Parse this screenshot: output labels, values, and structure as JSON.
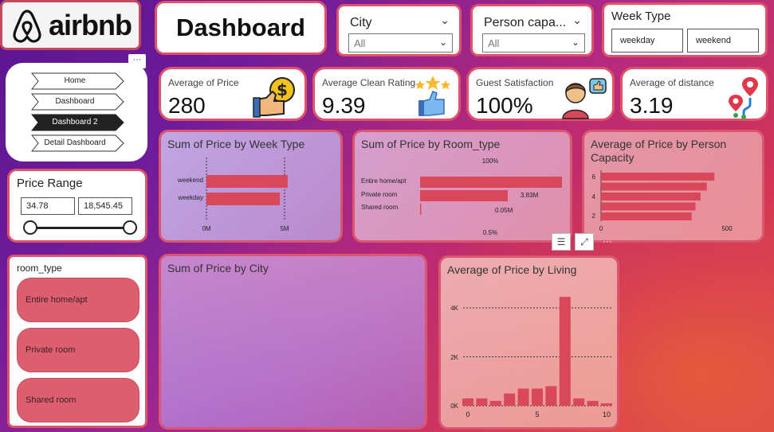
{
  "logo": {
    "word": "airbnb"
  },
  "header": {
    "title": "Dashboard"
  },
  "slicers": {
    "city": {
      "label": "City",
      "value": "All"
    },
    "person": {
      "label": "Person capa...",
      "value": "All"
    },
    "week_type": {
      "label": "Week Type",
      "options": [
        "weekday",
        "weekend"
      ]
    }
  },
  "more_label": "···",
  "nav": {
    "items": [
      {
        "label": "Home",
        "active": false
      },
      {
        "label": "Dashboard",
        "active": false
      },
      {
        "label": "Dashboard 2",
        "active": true
      },
      {
        "label": "Detail Dashboard",
        "active": false
      }
    ]
  },
  "price_range": {
    "title": "Price Range",
    "min": "34.78",
    "max": "18,545.45"
  },
  "room_type_slicer": {
    "title": "room_type",
    "items": [
      "Entire home/apt",
      "Private room",
      "Shared room"
    ]
  },
  "kpis": [
    {
      "label": "Average of Price",
      "value": "280",
      "icon": "money-hand-icon"
    },
    {
      "label": "Average Clean Rating",
      "value": "9.39",
      "icon": "thumbs-stars-icon"
    },
    {
      "label": "Guest Satisfaction",
      "value": "100%",
      "icon": "satisfied-guest-icon"
    },
    {
      "label": "Average of distance",
      "value": "3.19",
      "icon": "route-pin-icon"
    }
  ],
  "colors": {
    "accent": "#e0516a",
    "bar": "#d9485a"
  },
  "chart_data": [
    {
      "type": "bar",
      "orientation": "horizontal",
      "title": "Sum of Price by Week Type",
      "categories": [
        "weekend",
        "weekday"
      ],
      "values": [
        5.2,
        4.7
      ],
      "value_unit": "M",
      "xticks": [
        "0M",
        "5M"
      ],
      "xlim": [
        0,
        5.5
      ]
    },
    {
      "type": "bar",
      "orientation": "horizontal",
      "title": "Sum of Price by Room_type",
      "categories": [
        "Entire home/apt",
        "Private room",
        "Shared room"
      ],
      "values": [
        6.2,
        3.83,
        0.05
      ],
      "data_labels": [
        "100%",
        "3.83M",
        "0.05M"
      ],
      "pct_labels": [
        "0.5%"
      ]
    },
    {
      "type": "bar",
      "orientation": "horizontal",
      "title": "Average of Price by Person Capacity",
      "categories": [
        "6",
        "5",
        "4",
        "3",
        "2"
      ],
      "values": [
        450,
        420,
        395,
        375,
        360
      ],
      "yticks": [
        "6",
        "4",
        "2"
      ],
      "xticks": [
        "0",
        "500"
      ],
      "xlim": [
        0,
        570
      ]
    },
    {
      "type": "bar",
      "title": "Sum of Price by City",
      "categories": [],
      "values": []
    },
    {
      "type": "bar",
      "title": "Average of Price by Living",
      "x": [
        0,
        1,
        2,
        3,
        4,
        5,
        6,
        7,
        8,
        9,
        10
      ],
      "values": [
        300,
        300,
        200,
        500,
        700,
        700,
        800,
        4450,
        300,
        200,
        100
      ],
      "yticks": [
        "0K",
        "2K",
        "4K"
      ],
      "xticks": [
        "0",
        "5",
        "10"
      ],
      "ylim": [
        0,
        4700
      ],
      "grid": true
    }
  ]
}
